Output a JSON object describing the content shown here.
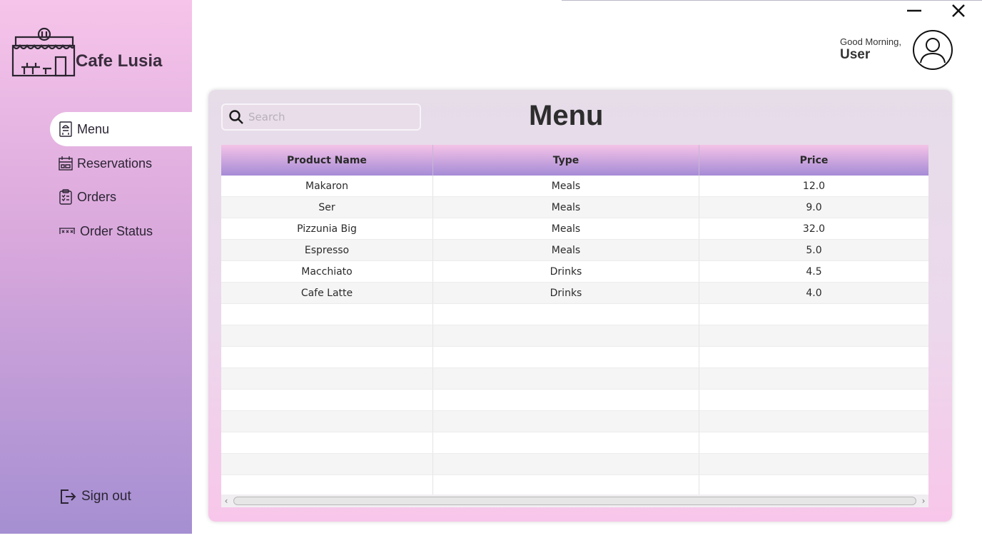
{
  "app": {
    "name": "Cafe Lusia"
  },
  "sidebar": {
    "items": [
      {
        "label": "Menu",
        "icon": "menu-icon",
        "active": true
      },
      {
        "label": "Reservations",
        "icon": "calendar-icon",
        "active": false
      },
      {
        "label": "Orders",
        "icon": "clipboard-icon",
        "active": false
      },
      {
        "label": "Order Status",
        "icon": "status-icon",
        "active": false
      }
    ],
    "signout": {
      "label": "Sign out",
      "icon": "sign-out-icon"
    }
  },
  "header": {
    "greeting": "Good Morning,",
    "user": "User"
  },
  "main": {
    "title": "Menu",
    "search": {
      "placeholder": "Search",
      "value": ""
    },
    "table": {
      "columns": [
        "Product Name",
        "Type",
        "Price"
      ],
      "rows": [
        [
          "Makaron",
          "Meals",
          "12.0"
        ],
        [
          "Ser",
          "Meals",
          "9.0"
        ],
        [
          "Pizzunia Big",
          "Meals",
          "32.0"
        ],
        [
          "Espresso",
          "Meals",
          "5.0"
        ],
        [
          "Macchiato",
          "Drinks",
          "4.5"
        ],
        [
          "Cafe Latte",
          "Drinks",
          "4.0"
        ],
        [
          "",
          "",
          ""
        ],
        [
          "",
          "",
          ""
        ],
        [
          "",
          "",
          ""
        ],
        [
          "",
          "",
          ""
        ],
        [
          "",
          "",
          ""
        ],
        [
          "",
          "",
          ""
        ],
        [
          "",
          "",
          ""
        ],
        [
          "",
          "",
          ""
        ],
        [
          "",
          "",
          ""
        ]
      ]
    }
  },
  "colors": {
    "sidebar_top": "#f6c4ea",
    "sidebar_bottom": "#a58fd2",
    "header_top": "#f5c3e7",
    "header_bottom": "#a58bd6"
  }
}
